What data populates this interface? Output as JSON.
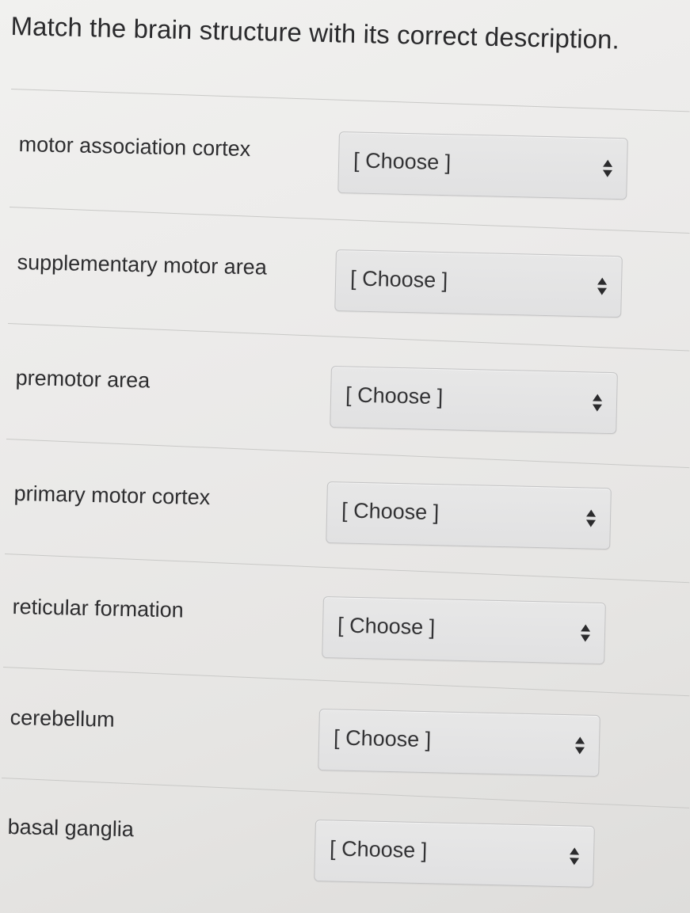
{
  "question": {
    "title": "Match the brain structure with its correct description."
  },
  "rows": [
    {
      "label": "motor association cortex",
      "select_value": "[ Choose ]"
    },
    {
      "label": "supplementary motor area",
      "select_value": "[ Choose ]"
    },
    {
      "label": "premotor area",
      "select_value": "[ Choose ]"
    },
    {
      "label": "primary motor cortex",
      "select_value": "[ Choose ]"
    },
    {
      "label": "reticular formation",
      "select_value": "[ Choose ]"
    },
    {
      "label": "cerebellum",
      "select_value": "[ Choose ]"
    },
    {
      "label": "basal ganglia",
      "select_value": "[ Choose ]"
    }
  ],
  "icons": {
    "select_indicator": "updown-arrows-icon"
  },
  "colors": {
    "background": "#ecebea",
    "select_background": "#e3e3e3",
    "select_border": "#c3c3c4",
    "text": "#2b2b2d",
    "divider": "#c9c9c7"
  }
}
